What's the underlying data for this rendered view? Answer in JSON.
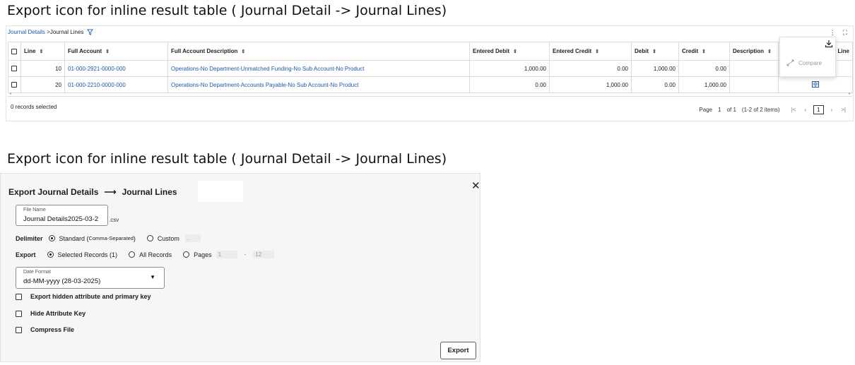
{
  "captions": {
    "top": "Export icon for inline result table ( Journal Detail -> Journal Lines)",
    "bottom": "Export icon for inline result table ( Journal Detail -> Journal Lines)"
  },
  "table_panel": {
    "breadcrumb": {
      "parent": "Journal Details",
      "separator": " >",
      "current": "Journal Lines"
    },
    "icons": [
      "filter-icon",
      "more-vertical-icon",
      "fullscreen-icon"
    ],
    "columns": [
      "Line",
      "Full Account",
      "Full Account Description",
      "Entered Debit",
      "Entered Credit",
      "Debit",
      "Credit",
      "Description",
      "Line"
    ],
    "rows": [
      {
        "line": "10",
        "account": "01-000-2921-0000-000",
        "description": "Operations-No Department-Unmatched Funding-No Sub Account-No Product",
        "entered_debit": "1,000.00",
        "entered_credit": "0.00",
        "debit": "1,000.00",
        "credit": "0.00"
      },
      {
        "line": "20",
        "account": "01-000-2210-0000-000",
        "description": "Operations-No Department-Accounts Payable-No Sub Account-No Product",
        "entered_debit": "0.00",
        "entered_credit": "1,000.00",
        "debit": "0.00",
        "credit": "1,000.00"
      }
    ],
    "records_selected": "0 records selected",
    "pagination": {
      "page_label": "Page",
      "page": "1",
      "of_label": "of 1",
      "items": "(1-2 of 2 items)",
      "current": "1"
    },
    "export_popup": {
      "compare_label": "Compare"
    }
  },
  "dialog": {
    "title_left": "Export Journal Details",
    "title_arrow": "⟶",
    "title_right": "Journal Lines",
    "file_name_label": "File Name",
    "file_name_value": "Journal Details2025-03-2",
    "file_ext": ".csv",
    "delimiter_label": "Delimiter",
    "delimiter_standard": "Standard (",
    "delimiter_standard_note": "Comma-Separated",
    "delimiter_standard_close": ")",
    "delimiter_custom": "Custom",
    "delimiter_custom_value": ".",
    "export_label": "Export",
    "export_selected": "Selected Records (1)",
    "export_all": "All Records",
    "export_pages": "Pages",
    "pages_from": "1",
    "pages_to": "12",
    "date_format_label": "Date Format",
    "date_format_value": "dd-MM-yyyy (28-03-2025)",
    "chk_hidden": "Export hidden attribute and primary key",
    "chk_hide_key": "Hide Attribute Key",
    "chk_compress": "Compress File",
    "export_button": "Export"
  },
  "colors": {
    "link": "#1f5aa8",
    "accent": "#1f5aa8"
  }
}
